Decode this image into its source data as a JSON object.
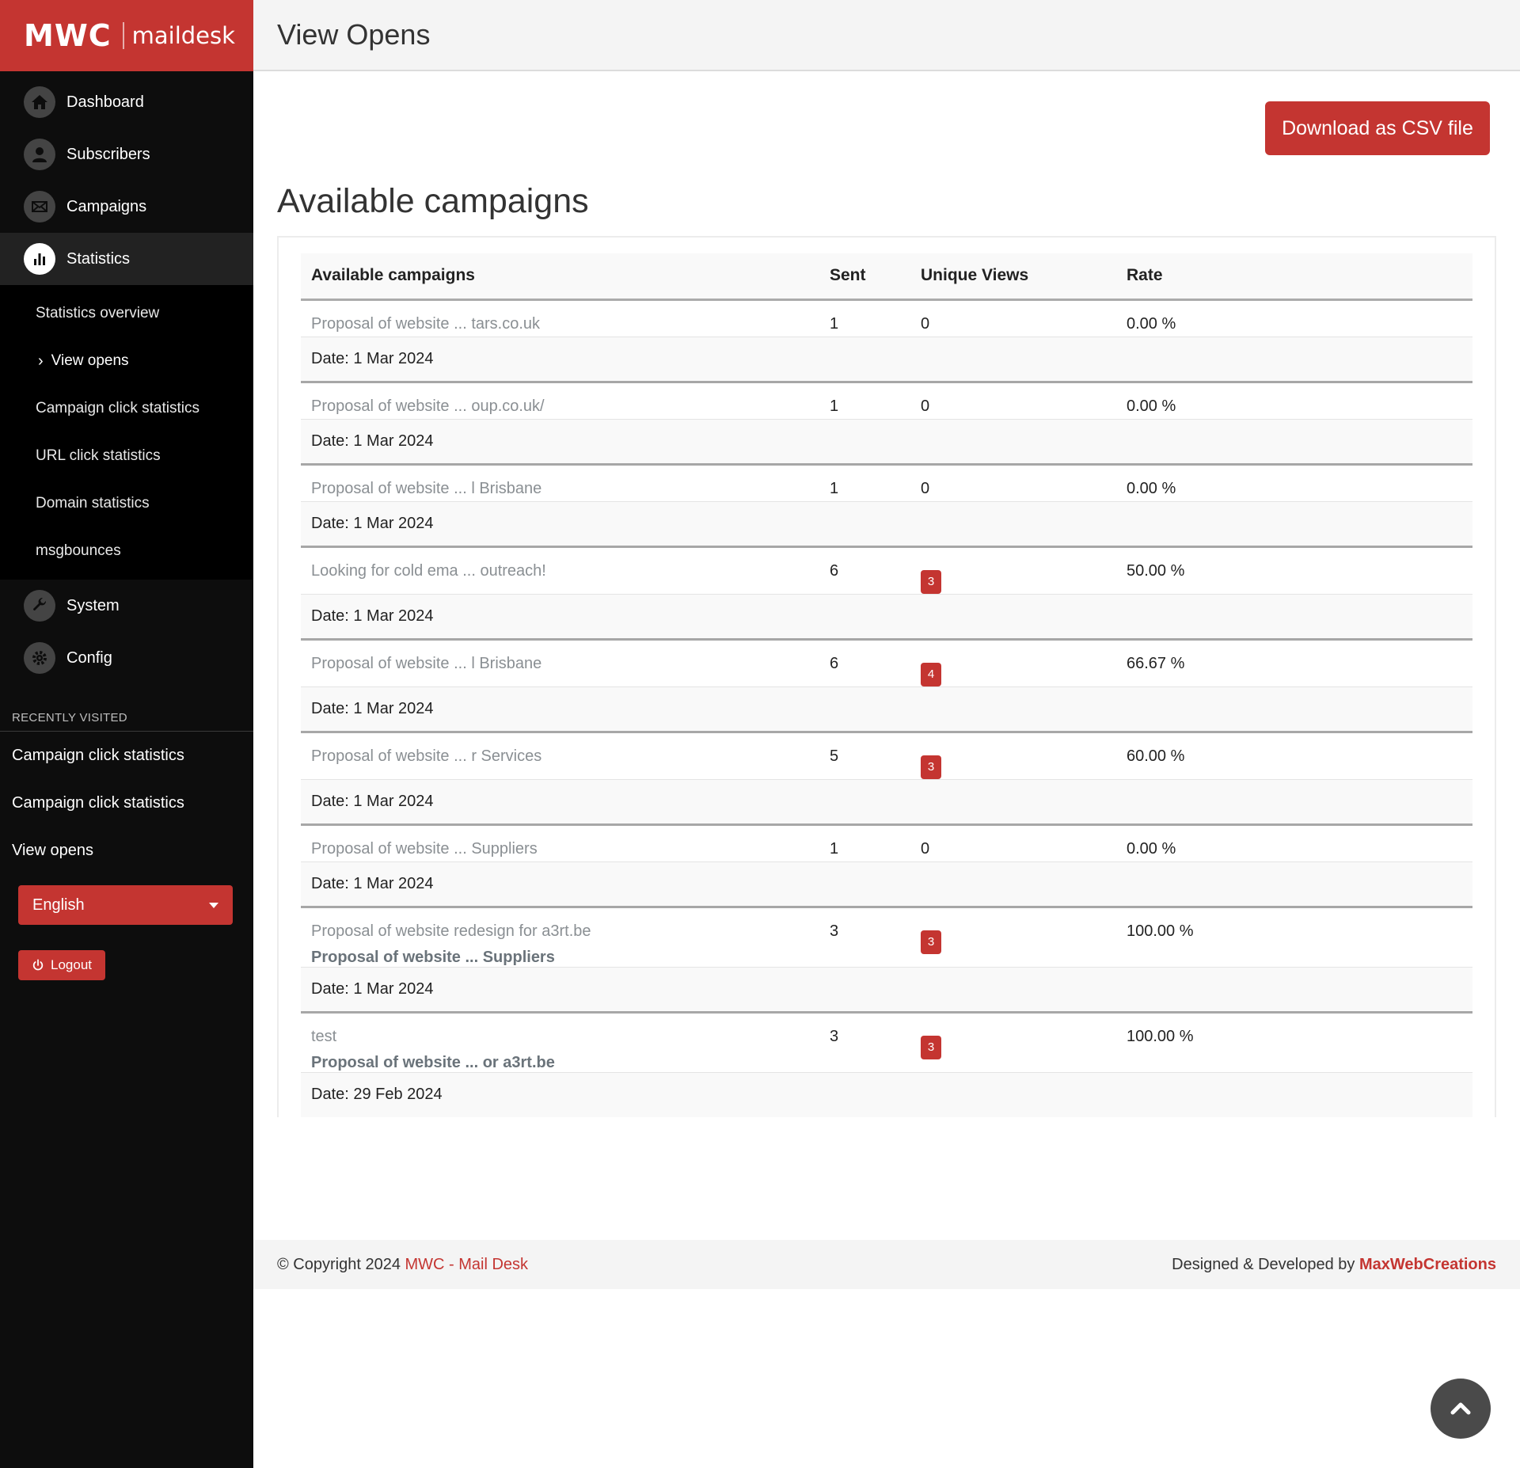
{
  "brand": {
    "logo": "MWC",
    "name": "maildesk"
  },
  "header": {
    "title": "View Opens"
  },
  "sidebar": {
    "items": [
      {
        "label": "Dashboard",
        "icon": "home-icon"
      },
      {
        "label": "Subscribers",
        "icon": "user-icon"
      },
      {
        "label": "Campaigns",
        "icon": "envelope-icon"
      },
      {
        "label": "Statistics",
        "icon": "bar-chart-icon"
      },
      {
        "label": "System",
        "icon": "wrench-icon"
      },
      {
        "label": "Config",
        "icon": "gear-icon"
      }
    ],
    "subitems": [
      {
        "label": "Statistics overview"
      },
      {
        "label": "View opens"
      },
      {
        "label": "Campaign click statistics"
      },
      {
        "label": "URL click statistics"
      },
      {
        "label": "Domain statistics"
      },
      {
        "label": "msgbounces"
      }
    ],
    "recent_heading": "RECENTLY VISITED",
    "recent": [
      {
        "label": "Campaign click statistics"
      },
      {
        "label": "Campaign click statistics"
      },
      {
        "label": "View opens"
      }
    ],
    "language": "English",
    "logout": "Logout"
  },
  "main": {
    "csv_button": "Download as CSV file",
    "section_title": "Available campaigns",
    "columns": {
      "campaign": "Available campaigns",
      "sent": "Sent",
      "unique": "Unique Views",
      "rate": "Rate"
    },
    "rows": [
      {
        "title": "Proposal of website ... tars.co.uk",
        "sub": "",
        "sent": "1",
        "unique": "0",
        "rate": "0.00 %",
        "date": "Date: 1 Mar 2024"
      },
      {
        "title": "Proposal of website ... oup.co.uk/",
        "sub": "",
        "sent": "1",
        "unique": "0",
        "rate": "0.00 %",
        "date": "Date: 1 Mar 2024"
      },
      {
        "title": "Proposal of website ... l Brisbane",
        "sub": "",
        "sent": "1",
        "unique": "0",
        "rate": "0.00 %",
        "date": "Date: 1 Mar 2024"
      },
      {
        "title": "Looking for cold ema ... outreach!",
        "sub": "",
        "sent": "6",
        "unique": "3",
        "rate": "50.00 %",
        "date": "Date: 1 Mar 2024"
      },
      {
        "title": "Proposal of website ... l Brisbane",
        "sub": "",
        "sent": "6",
        "unique": "4",
        "rate": "66.67 %",
        "date": "Date: 1 Mar 2024"
      },
      {
        "title": "Proposal of website ... r Services",
        "sub": "",
        "sent": "5",
        "unique": "3",
        "rate": "60.00 %",
        "date": "Date: 1 Mar 2024"
      },
      {
        "title": "Proposal of website ... Suppliers",
        "sub": "",
        "sent": "1",
        "unique": "0",
        "rate": "0.00 %",
        "date": "Date: 1 Mar 2024"
      },
      {
        "title": "Proposal of website redesign for a3rt.be",
        "sub": "Proposal of website ... Suppliers",
        "sent": "3",
        "unique": "3",
        "rate": "100.00 %",
        "date": "Date: 1 Mar 2024"
      },
      {
        "title": "test",
        "sub": "Proposal of website ... or a3rt.be",
        "sent": "3",
        "unique": "3",
        "rate": "100.00 %",
        "date": "Date: 29 Feb 2024"
      }
    ]
  },
  "footer": {
    "copyright": "© Copyright 2024 ",
    "brand_link": "MWC - Mail Desk",
    "designed": "Designed & Developed by ",
    "dev_link": "MaxWebCreations"
  },
  "colors": {
    "accent": "#c43531",
    "sidebar": "#0d0d0d"
  }
}
